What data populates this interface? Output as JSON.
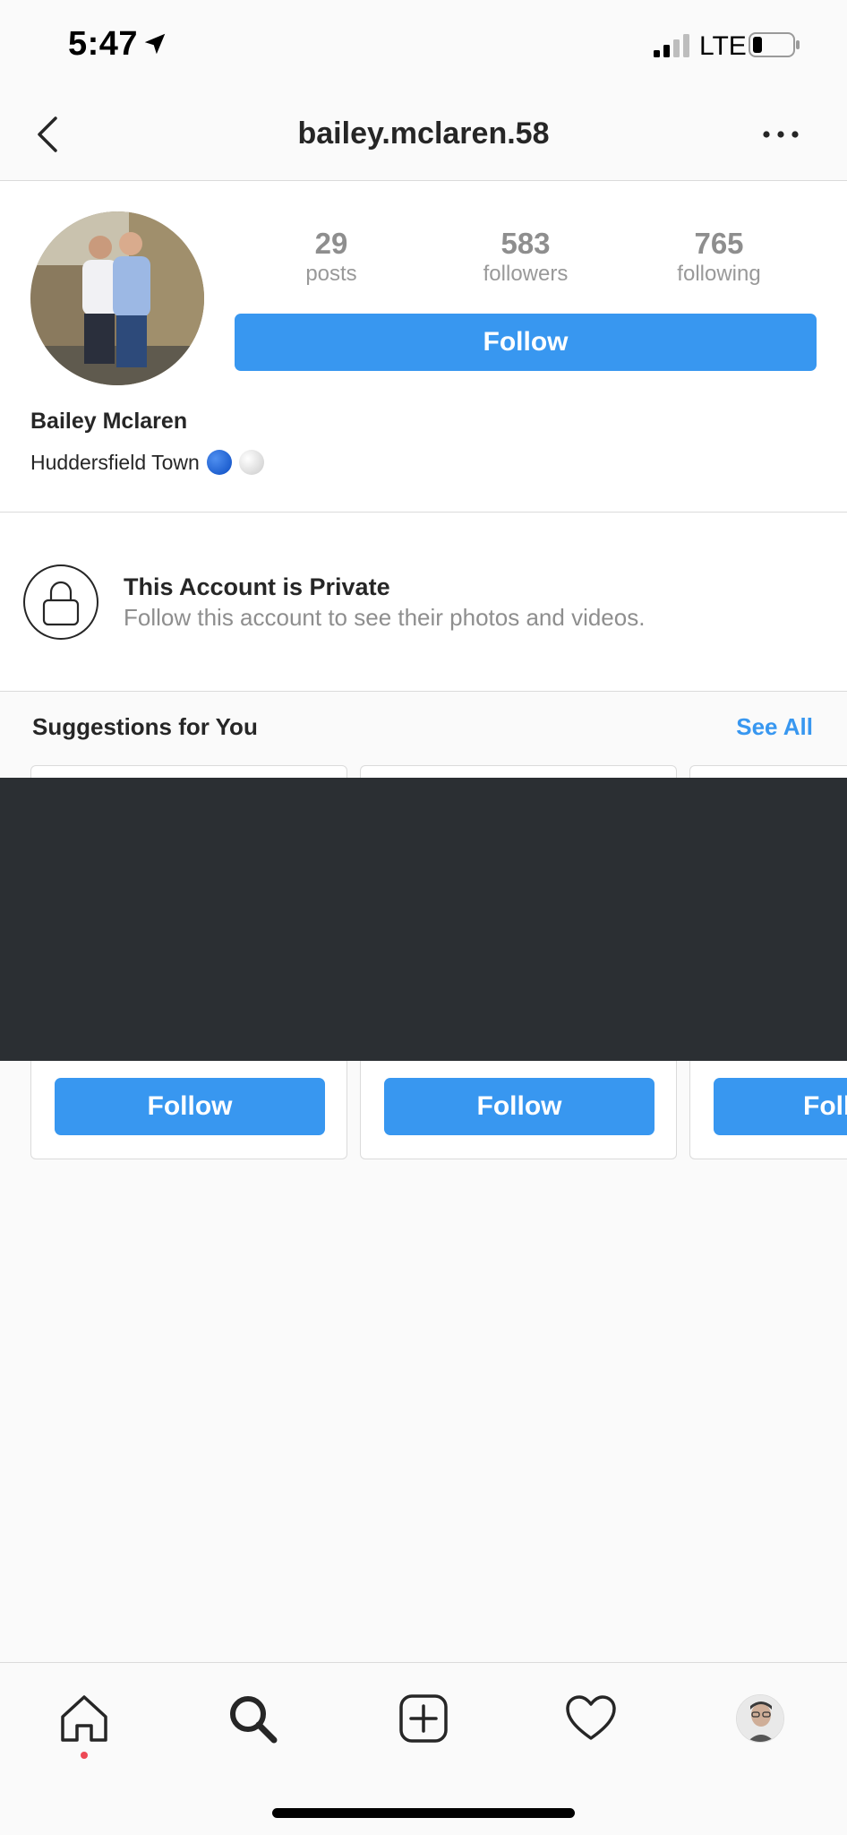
{
  "status_bar": {
    "time": "5:47",
    "carrier": "LTE",
    "icons": [
      "location-arrow-icon",
      "cellular-signal-icon",
      "battery-icon"
    ]
  },
  "header": {
    "title": "bailey.mclaren.58",
    "icons": [
      "chevron-left-icon",
      "more-horizontal-icon"
    ]
  },
  "profile": {
    "stats": [
      {
        "value": "29",
        "label": "posts"
      },
      {
        "value": "583",
        "label": "followers"
      },
      {
        "value": "765",
        "label": "following"
      }
    ],
    "follow_label": "Follow",
    "full_name": "Bailey Mclaren",
    "bio": "Huddersfield Town",
    "bio_emoji_colors": [
      "#1565d8",
      "#e0e0e0"
    ],
    "accent_color": "#3897f0"
  },
  "private_notice": {
    "title": "This Account is Private",
    "subtitle": "Follow this account to see their photos and videos.",
    "icon": "lock-icon"
  },
  "suggestions": {
    "title": "Suggestions for You",
    "see_all": "See All",
    "cards": [
      {
        "follow_label": "Follow"
      },
      {
        "follow_label": "Follow"
      },
      {
        "follow_label": "Follow"
      }
    ]
  },
  "tab_bar": {
    "items": [
      "home-icon",
      "search-icon",
      "add-post-icon",
      "heart-icon",
      "profile-avatar"
    ],
    "notification_dot_color": "#ed4956"
  }
}
